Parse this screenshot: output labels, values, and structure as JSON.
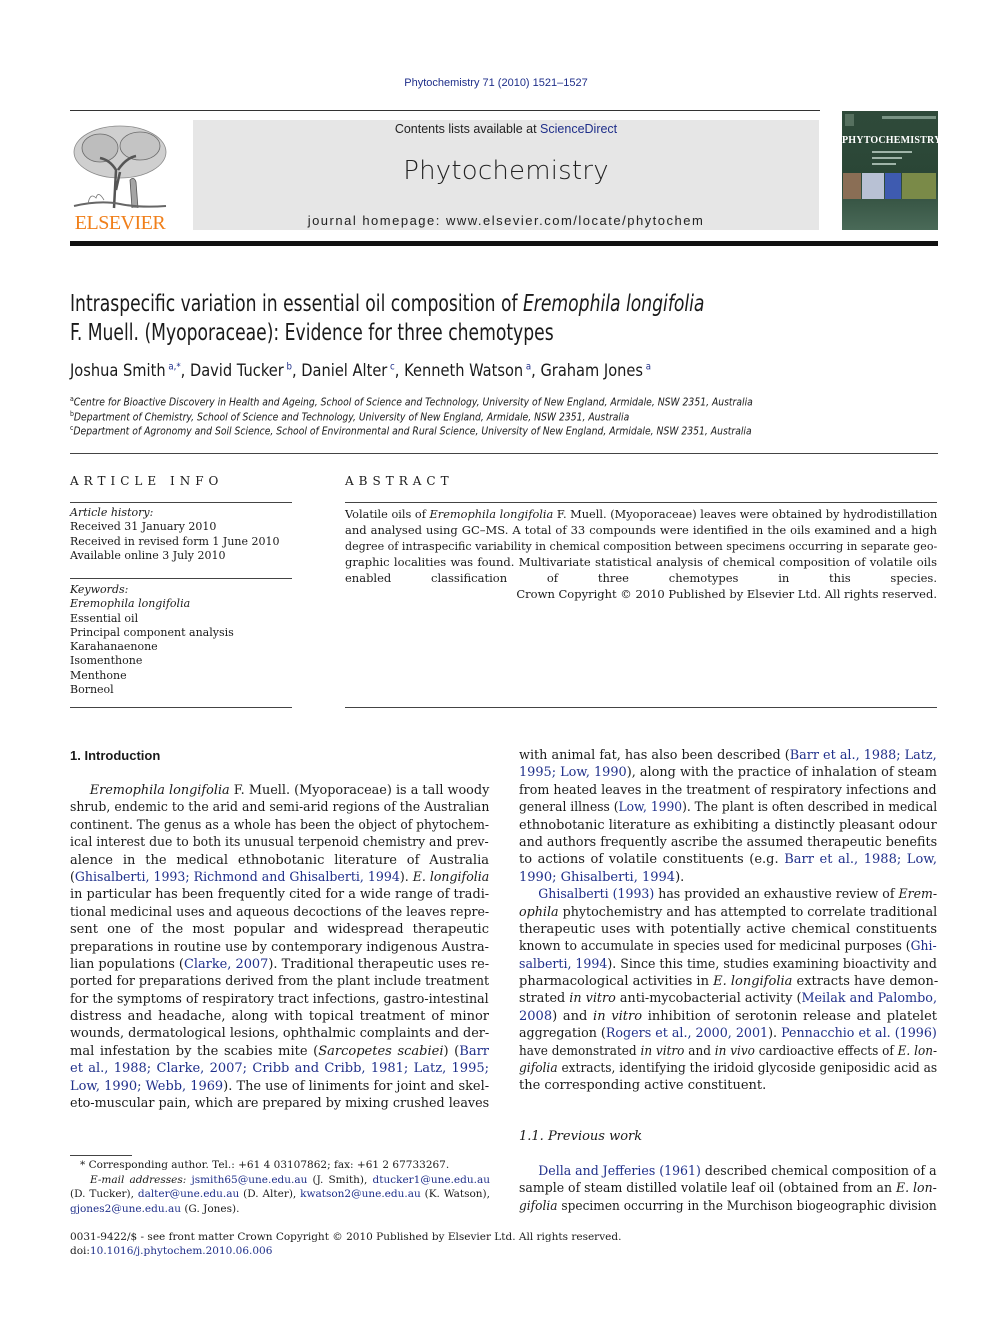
{
  "header": {
    "journal_ref": "Phytochemistry 71 (2010) 1521–1527",
    "contents_prefix": "Contents lists available at ",
    "contents_link": "ScienceDirect",
    "journal_name": "Phytochemistry",
    "homepage": "journal homepage: www.elsevier.com/locate/phytochem",
    "publisher_logo_text": "ELSEVIER",
    "cover_title": "PHYTOCHEMISTRY",
    "colors": {
      "link": "#1f2f8a",
      "elsevier_orange": "#f07f1a",
      "masthead_bg": "#e6e6e6",
      "cover_green": "#2f4a3a"
    }
  },
  "article": {
    "title_line1_plain": "Intraspecific variation in essential oil composition of ",
    "title_line1_italic": "Eremophila longifolia",
    "title_line2": "F. Muell. (Myoporaceae): Evidence for three chemotypes",
    "authors": [
      {
        "name": "Joshua Smith",
        "sup": "a,*"
      },
      {
        "name": "David Tucker",
        "sup": "b"
      },
      {
        "name": "Daniel Alter",
        "sup": "c"
      },
      {
        "name": "Kenneth Watson",
        "sup": "a"
      },
      {
        "name": "Graham Jones",
        "sup": "a"
      }
    ],
    "affiliations": [
      {
        "key": "a",
        "text": "Centre for Bioactive Discovery in Health and Ageing, School of Science and Technology, University of New England, Armidale, NSW 2351, Australia"
      },
      {
        "key": "b",
        "text": "Department of Chemistry, School of Science and Technology, University of New England, Armidale, NSW 2351, Australia"
      },
      {
        "key": "c",
        "text": "Department of Agronomy and Soil Science, School of Environmental and Rural Science, University of New England, Armidale, NSW 2351, Australia"
      }
    ]
  },
  "article_info": {
    "heading": "ARTICLE INFO",
    "history_label": "Article history:",
    "history": [
      "Received 31 January 2010",
      "Received in revised form 1 June 2010",
      "Available online 3 July 2010"
    ],
    "keywords_label": "Keywords:",
    "keywords": [
      "Eremophila longifolia",
      "Essential oil",
      "Principal component analysis",
      "Karahanaenone",
      "Isomenthone",
      "Menthone",
      "Borneol"
    ]
  },
  "abstract": {
    "heading": "ABSTRACT",
    "lines": [
      [
        {
          "t": "Volatile oils of "
        },
        {
          "t": "Eremophila longifolia",
          "s": "it"
        },
        {
          "t": " F. Muell. (Myoporaceae) leaves were obtained by hydrodistillation"
        }
      ],
      [
        {
          "t": "and analysed using GC–MS. A total of 33 compounds were identified in the oils examined and a high"
        }
      ],
      [
        {
          "t": "degree of intraspecific variability in chemical composition between specimens occurring in separate geo-"
        }
      ],
      [
        {
          "t": "graphic localities was found. Multivariate statistical analysis of chemical composition of volatile oils"
        }
      ],
      [
        {
          "t": "enabled classification of three chemotypes in this species."
        }
      ]
    ],
    "copyright": "Crown Copyright © 2010 Published by Elsevier Ltd. All rights reserved."
  },
  "body": {
    "section1_heading": "1. Introduction",
    "left_lines": [
      [
        {
          "t": "Eremophila longifolia",
          "s": "it"
        },
        {
          "t": " F. Muell. (Myoporaceae) is a tall woody"
        }
      ],
      [
        {
          "t": "shrub, endemic to the arid and semi-arid regions of the Australian"
        }
      ],
      [
        {
          "t": "continent. The genus as a whole has been the object of phytochem-"
        }
      ],
      [
        {
          "t": "ical interest due to both its unusual terpenoid chemistry and prev-"
        }
      ],
      [
        {
          "t": "alence in the medical ethnobotanic literature of Australia"
        }
      ],
      [
        {
          "t": "("
        },
        {
          "t": "Ghisalberti, 1993; Richmond and Ghisalberti, 1994",
          "s": "link"
        },
        {
          "t": "). "
        },
        {
          "t": "E. longifolia",
          "s": "it"
        }
      ],
      [
        {
          "t": "in particular has been frequently cited for a wide range of tradi-"
        }
      ],
      [
        {
          "t": "tional medicinal uses and aqueous decoctions of the leaves repre-"
        }
      ],
      [
        {
          "t": "sent one of the most popular and widespread therapeutic"
        }
      ],
      [
        {
          "t": "preparations in routine use by contemporary indigenous Austra-"
        }
      ],
      [
        {
          "t": "lian populations ("
        },
        {
          "t": "Clarke, 2007",
          "s": "link"
        },
        {
          "t": "). Traditional therapeutic uses re-"
        }
      ],
      [
        {
          "t": "ported for preparations derived from the plant include treatment"
        }
      ],
      [
        {
          "t": "for the symptoms of respiratory tract infections, gastro-intestinal"
        }
      ],
      [
        {
          "t": "distress and headache, along with topical treatment of minor"
        }
      ],
      [
        {
          "t": "wounds, dermatological lesions, ophthalmic complaints and der-"
        }
      ],
      [
        {
          "t": "mal infestation by the scabies mite ("
        },
        {
          "t": "Sarcopetes scabiei",
          "s": "it"
        },
        {
          "t": ") ("
        },
        {
          "t": "Barr",
          "s": "link"
        }
      ],
      [
        {
          "t": "et al., 1988; Clarke, 2007; Cribb and Cribb, 1981; Latz, 1995;",
          "s": "link"
        }
      ],
      [
        {
          "t": "Low, 1990; Webb, 1969",
          "s": "link"
        },
        {
          "t": "). The use of liniments for joint and skel-"
        }
      ],
      [
        {
          "t": "eto-muscular pain, which are prepared by mixing crushed leaves"
        }
      ]
    ],
    "right_lines_p1": [
      [
        {
          "t": "with animal fat, has also been described ("
        },
        {
          "t": "Barr et al., 1988; Latz,",
          "s": "link"
        }
      ],
      [
        {
          "t": "1995; Low, 1990",
          "s": "link"
        },
        {
          "t": "), along with the practice of inhalation of steam"
        }
      ],
      [
        {
          "t": "from heated leaves in the treatment of respiratory infections and"
        }
      ],
      [
        {
          "t": "general illness ("
        },
        {
          "t": "Low, 1990",
          "s": "link"
        },
        {
          "t": "). The plant is often described in medical"
        }
      ],
      [
        {
          "t": "ethnobotanic literature as exhibiting a distinctly pleasant odour"
        }
      ],
      [
        {
          "t": "and authors frequently ascribe the assumed therapeutic benefits"
        }
      ],
      [
        {
          "t": "to actions of volatile constituents (e.g. "
        },
        {
          "t": "Barr et al., 1988; Low,",
          "s": "link"
        }
      ],
      [
        {
          "t": "1990; Ghisalberti, 1994",
          "s": "link"
        },
        {
          "t": ")."
        }
      ]
    ],
    "right_lines_p2": [
      [
        {
          "t": "Ghisalberti (1993)",
          "s": "link"
        },
        {
          "t": " has provided an exhaustive review of "
        },
        {
          "t": "Erem-",
          "s": "it"
        }
      ],
      [
        {
          "t": "ophila",
          "s": "it"
        },
        {
          "t": " phytochemistry and has attempted to correlate traditional"
        }
      ],
      [
        {
          "t": "therapeutic uses with potentially active chemical constituents"
        }
      ],
      [
        {
          "t": "known to accumulate in species used for medicinal purposes ("
        },
        {
          "t": "Ghi-",
          "s": "link"
        }
      ],
      [
        {
          "t": "salberti, 1994",
          "s": "link"
        },
        {
          "t": "). Since this time, studies examining bioactivity and"
        }
      ],
      [
        {
          "t": "pharmacological activities in "
        },
        {
          "t": "E. longifolia",
          "s": "it"
        },
        {
          "t": " extracts have demon-"
        }
      ],
      [
        {
          "t": "strated "
        },
        {
          "t": "in vitro",
          "s": "it"
        },
        {
          "t": " anti-mycobacterial activity ("
        },
        {
          "t": "Meilak and Palombo,",
          "s": "link"
        }
      ],
      [
        {
          "t": "2008",
          "s": "link"
        },
        {
          "t": ") and "
        },
        {
          "t": "in vitro",
          "s": "it"
        },
        {
          "t": " inhibition of serotonin release and platelet"
        }
      ],
      [
        {
          "t": "aggregation ("
        },
        {
          "t": "Rogers et al., 2000, 2001",
          "s": "link"
        },
        {
          "t": "). "
        },
        {
          "t": "Pennacchio et al. (1996)",
          "s": "link"
        }
      ],
      [
        {
          "t": "have demonstrated "
        },
        {
          "t": "in vitro",
          "s": "it"
        },
        {
          "t": " and "
        },
        {
          "t": "in vivo",
          "s": "it"
        },
        {
          "t": " cardioactive effects of "
        },
        {
          "t": "E. lon-",
          "s": "it"
        }
      ],
      [
        {
          "t": "gifolia",
          "s": "it"
        },
        {
          "t": " extracts, identifying the iridoid glycoside geniposidic acid as"
        }
      ],
      [
        {
          "t": "the corresponding active constituent."
        }
      ]
    ],
    "subsection_heading": "1.1. Previous work",
    "right_lines_p3": [
      [
        {
          "t": "Della and Jefferies (1961)",
          "s": "link"
        },
        {
          "t": " described chemical composition of a"
        }
      ],
      [
        {
          "t": "sample of steam distilled volatile leaf oil (obtained from an "
        },
        {
          "t": "E. lon-",
          "s": "it"
        }
      ],
      [
        {
          "t": "gifolia",
          "s": "it"
        },
        {
          "t": " specimen occurring in the Murchison biogeographic division"
        }
      ]
    ]
  },
  "footnote": {
    "corresponding": "* Corresponding author. Tel.: +61 4 03107862; fax: +61 2 67733267.",
    "email_label": "E-mail addresses:",
    "emails": [
      {
        "address": "jsmith65@une.edu.au",
        "who": "(J. Smith),"
      },
      {
        "address": "dtucker1@une.edu.au",
        "who": "(D. Tucker),"
      },
      {
        "address": "dalter@une.edu.au",
        "who": "(D. Alter),"
      },
      {
        "address": "kwatson2@une.edu.au",
        "who": "(K. Watson),"
      },
      {
        "address": "gjones2@une.edu.au",
        "who": "(G. Jones)."
      }
    ]
  },
  "bottom": {
    "issn_line": "0031-9422/$ - see front matter Crown Copyright © 2010 Published by Elsevier Ltd. All rights reserved.",
    "doi_prefix": "doi:",
    "doi": "10.1016/j.phytochem.2010.06.006"
  }
}
